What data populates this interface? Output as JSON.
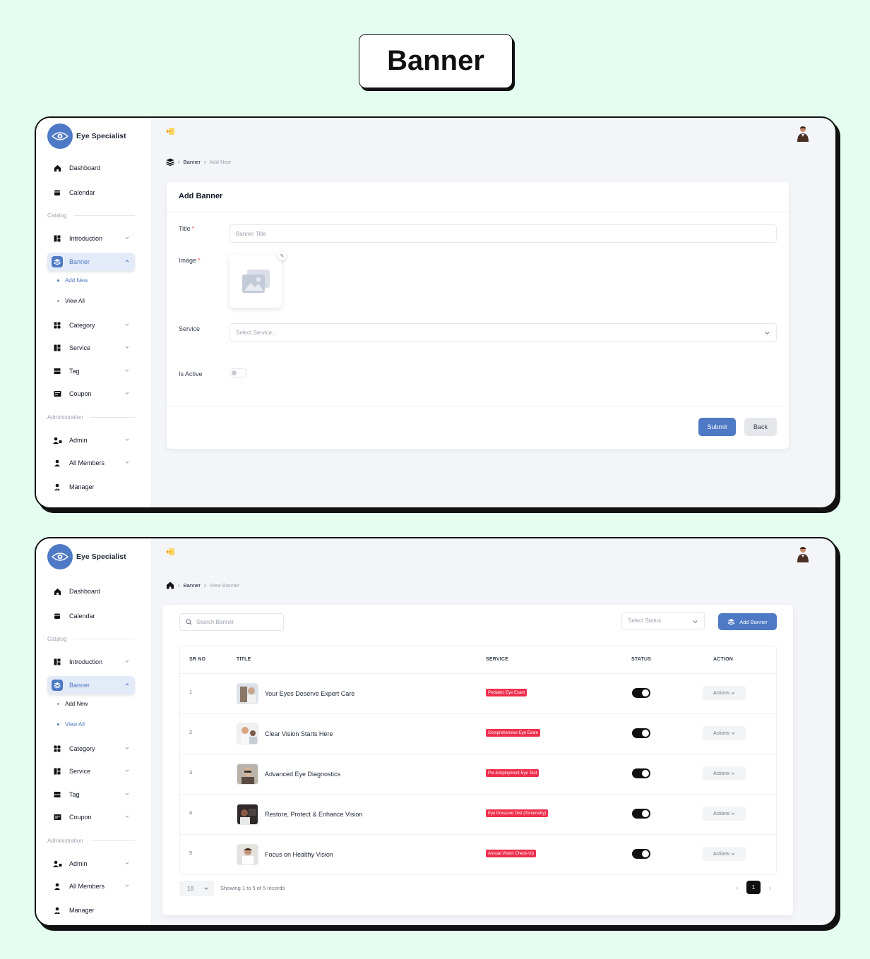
{
  "page_title": "Banner",
  "app": {
    "name": "Eye Specialist"
  },
  "sidebar": {
    "dashboard": "Dashboard",
    "calendar": "Calendar",
    "catalog_label": "Catalog",
    "introduction": "Introduction",
    "banner": "Banner",
    "add_new": "Add New",
    "view_all": "View All",
    "category": "Category",
    "service": "Service",
    "tag": "Tag",
    "coupon": "Coupon",
    "administration_label": "Administration",
    "admin": "Admin",
    "all_members": "All Members",
    "manager": "Manager"
  },
  "add_screen": {
    "breadcrumb": {
      "section": "Banner",
      "current": "Add New"
    },
    "card_title": "Add Banner",
    "title_label": "Title",
    "title_placeholder": "Banner Title",
    "image_label": "Image",
    "service_label": "Service",
    "service_placeholder": "Select Service...",
    "active_label": "Is Active",
    "submit": "Submit",
    "back": "Back",
    "required_mark": "*"
  },
  "list_screen": {
    "breadcrumb": {
      "section": "Banner",
      "current": "View Banner"
    },
    "search_placeholder": "Search Banner",
    "status_placeholder": "Select Status",
    "add_button": "Add Banner",
    "columns": {
      "sr": "SR NO",
      "title": "TITLE",
      "service": "SERVICE",
      "status": "STATUS",
      "action": "ACTION"
    },
    "rows": [
      {
        "sr": "1",
        "title": "Your Eyes Deserve Expert Care",
        "service": "Pediatric Eye Exam",
        "active": true,
        "action": "Actions"
      },
      {
        "sr": "2",
        "title": "Clear Vision Starts Here",
        "service": "Comprehensive Eye Exam",
        "active": true,
        "action": "Actions"
      },
      {
        "sr": "3",
        "title": "Advanced Eye Diagnostics",
        "service": "Pre-Employment Eye Test",
        "active": true,
        "action": "Actions"
      },
      {
        "sr": "4",
        "title": "Restore, Protect & Enhance Vision",
        "service": "Eye Pressure Test (Tonometry)",
        "active": true,
        "action": "Actions"
      },
      {
        "sr": "5",
        "title": "Focus on Healthy Vision",
        "service": "Annual Vision Check-Up",
        "active": true,
        "action": "Actions"
      }
    ],
    "page_size": "10",
    "showing": "Showing 1 to 5 of 5 records",
    "current_page": "1"
  },
  "colors": {
    "background": "#e5fcf1",
    "primary": "#4e79c4",
    "service_badge": "#ef2f4d",
    "toggle_on": "#111111"
  },
  "icons": [
    "logo-eye-icon",
    "home-icon",
    "calendar-icon",
    "layers-icon",
    "category-icon",
    "tag-icon",
    "coupon-icon",
    "admin-icon",
    "user-icon",
    "collapse-icon",
    "search-icon",
    "chevron-down-icon",
    "pencil-icon",
    "image-placeholder-icon"
  ]
}
